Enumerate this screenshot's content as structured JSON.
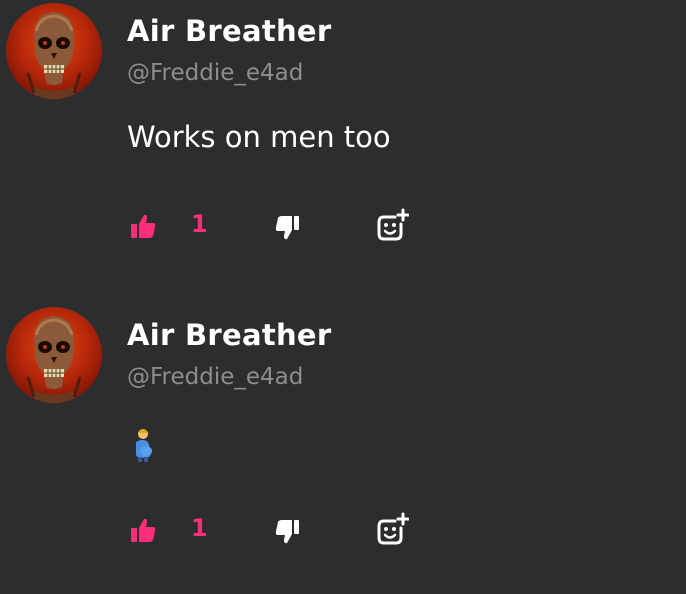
{
  "posts": [
    {
      "author_name": "Air Breather",
      "author_handle": "@Freddie_e4ad",
      "content_text": "Works on men too",
      "content_emoji": "",
      "like_count": "1"
    },
    {
      "author_name": "Air Breather",
      "author_handle": "@Freddie_e4ad",
      "content_text": "",
      "content_emoji": "pregnant-man-emoji",
      "like_count": "1"
    }
  ],
  "colors": {
    "background": "#2b2d2e",
    "accent": "#ff2d7a",
    "name": "#ffffff",
    "handle": "#8e8e8e"
  },
  "icons": {
    "like": "thumbs-up-icon",
    "dislike": "thumbs-down-icon",
    "react": "add-reaction-icon"
  }
}
